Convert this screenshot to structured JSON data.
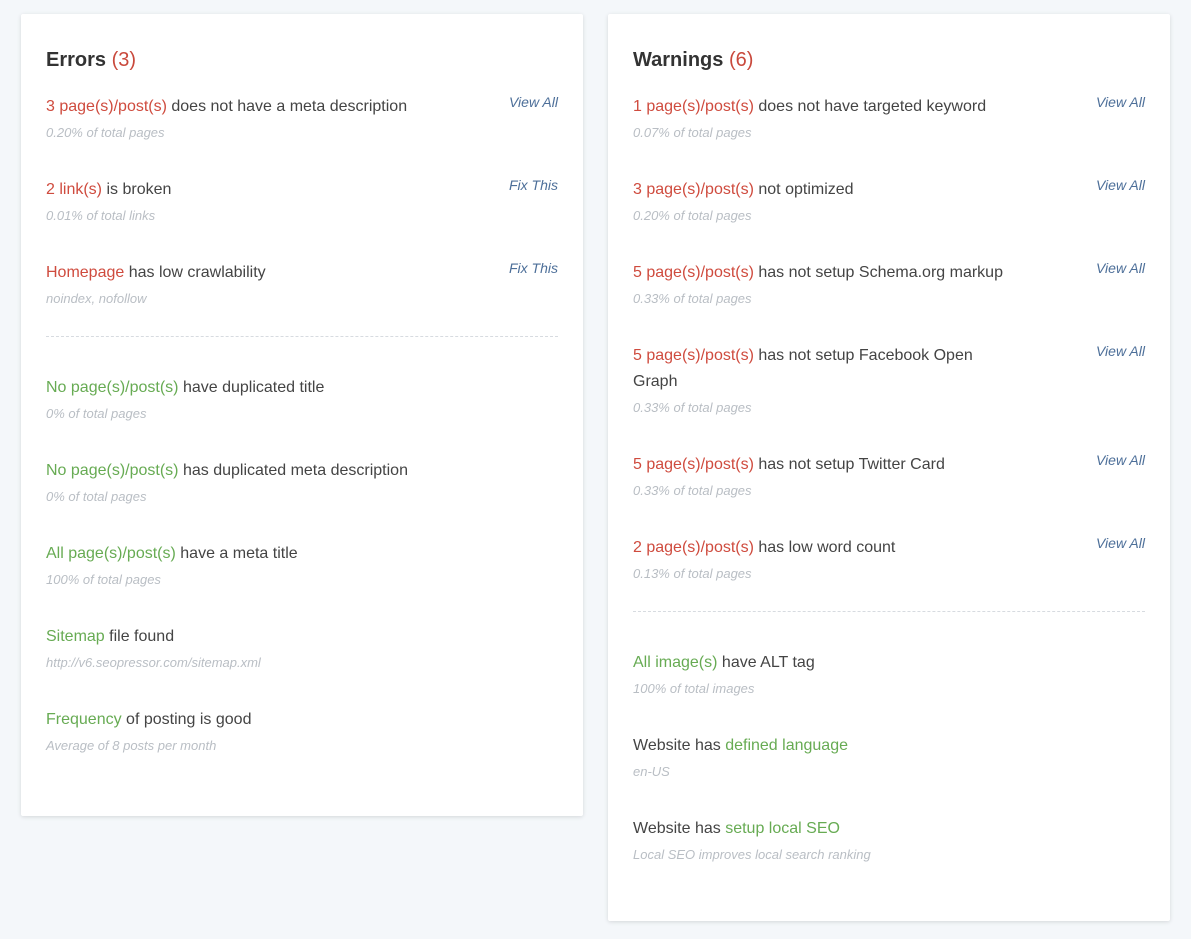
{
  "errors": {
    "title": "Errors",
    "count": "(3)",
    "issues": [
      {
        "highlight": "3 page(s)/post(s)",
        "text": " does not have a meta description",
        "sub": "0.20% of total pages",
        "action": "View All"
      },
      {
        "highlight": "2 link(s)",
        "text": " is broken",
        "sub": "0.01% of total links",
        "action": "Fix This"
      },
      {
        "highlight": "Homepage",
        "text": " has low crawlability",
        "sub": "noindex, nofollow",
        "action": "Fix This"
      }
    ],
    "passed": [
      {
        "highlight": "No page(s)/post(s)",
        "text": " have duplicated title",
        "sub": "0% of total pages"
      },
      {
        "highlight": "No page(s)/post(s)",
        "text": " has duplicated meta description",
        "sub": "0% of total pages"
      },
      {
        "highlight": "All page(s)/post(s)",
        "text": " have a meta title",
        "sub": "100% of total pages"
      },
      {
        "highlight": "Sitemap",
        "text": " file found",
        "sub": "http://v6.seopressor.com/sitemap.xml"
      },
      {
        "highlight": "Frequency",
        "text": " of posting is good",
        "sub": "Average of 8 posts per month"
      }
    ]
  },
  "warnings": {
    "title": "Warnings",
    "count": "(6)",
    "issues": [
      {
        "highlight": "1 page(s)/post(s)",
        "text": " does not have targeted keyword",
        "sub": "0.07% of total pages",
        "action": "View All"
      },
      {
        "highlight": "3 page(s)/post(s)",
        "text": " not optimized",
        "sub": "0.20% of total pages",
        "action": "View All"
      },
      {
        "highlight": "5 page(s)/post(s)",
        "text": " has not setup Schema.org markup",
        "sub": "0.33% of total pages",
        "action": "View All"
      },
      {
        "highlight": "5 page(s)/post(s)",
        "text": " has not setup Facebook Open Graph",
        "sub": "0.33% of total pages",
        "action": "View All"
      },
      {
        "highlight": "5 page(s)/post(s)",
        "text": " has not setup Twitter Card",
        "sub": "0.33% of total pages",
        "action": "View All"
      },
      {
        "highlight": "2 page(s)/post(s)",
        "text": " has low word count",
        "sub": "0.13% of total pages",
        "action": "View All"
      }
    ],
    "passed": [
      {
        "pre": "",
        "highlight": "All image(s)",
        "text": " have ALT tag",
        "sub": "100% of total images"
      },
      {
        "pre": "Website has ",
        "highlight": "defined language",
        "text": "",
        "sub": "en-US"
      },
      {
        "pre": "Website has ",
        "highlight": "setup local SEO",
        "text": "",
        "sub": "Local SEO improves local search ranking"
      }
    ]
  },
  "colors": {
    "error_accent": "#cf4b3e",
    "pass_accent": "#67ab53",
    "link": "#4d6f99",
    "muted": "#b9bec4"
  }
}
